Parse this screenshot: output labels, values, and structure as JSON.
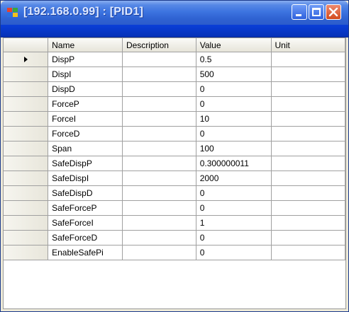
{
  "window": {
    "title": "[192.168.0.99] : [PID1]",
    "icon": "app-window-icon",
    "controls": [
      "minimize-icon",
      "maximize-icon",
      "close-icon"
    ]
  },
  "grid": {
    "columns": [
      "Name",
      "Description",
      "Value",
      "Unit"
    ],
    "current_row_indicator": "row-pointer-icon",
    "rows": [
      {
        "name": "DispP",
        "description": "",
        "value": "0.5",
        "unit": ""
      },
      {
        "name": "DispI",
        "description": "",
        "value": "500",
        "unit": ""
      },
      {
        "name": "DispD",
        "description": "",
        "value": "0",
        "unit": ""
      },
      {
        "name": "ForceP",
        "description": "",
        "value": "0",
        "unit": ""
      },
      {
        "name": "ForceI",
        "description": "",
        "value": "10",
        "unit": ""
      },
      {
        "name": "ForceD",
        "description": "",
        "value": "0",
        "unit": ""
      },
      {
        "name": "Span",
        "description": "",
        "value": "100",
        "unit": ""
      },
      {
        "name": "SafeDispP",
        "description": "",
        "value": "0.300000011",
        "unit": ""
      },
      {
        "name": "SafeDispI",
        "description": "",
        "value": "2000",
        "unit": ""
      },
      {
        "name": "SafeDispD",
        "description": "",
        "value": "0",
        "unit": ""
      },
      {
        "name": "SafeForceP",
        "description": "",
        "value": "0",
        "unit": ""
      },
      {
        "name": "SafeForceI",
        "description": "",
        "value": "1",
        "unit": ""
      },
      {
        "name": "SafeForceD",
        "description": "",
        "value": "0",
        "unit": ""
      },
      {
        "name": "EnableSafePi",
        "description": "",
        "value": "0",
        "unit": ""
      }
    ]
  }
}
